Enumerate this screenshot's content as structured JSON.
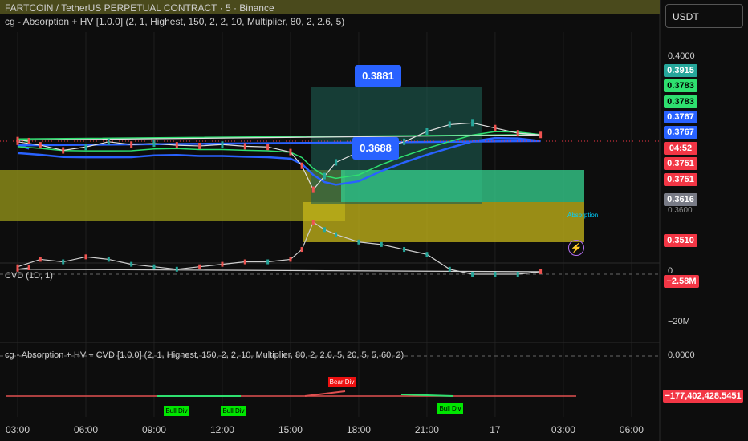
{
  "header": {
    "symbol_line": "FARTCOIN / TetherUS PERPETUAL CONTRACT · 5 · Binance",
    "indicator_line": "cg - Absorption + HV [1.0.0] (2, 1, Highest, 150, 2, 2, 10, Multiplier, 80, 2, 2.6, 5)",
    "currency": "USDT"
  },
  "callouts": {
    "upper": "0.3881",
    "lower": "0.3688"
  },
  "cvd": {
    "title": "CVD (1D, 1)",
    "value_tag": "−2.58M",
    "tick_low": "−20M",
    "tick_zero": "0"
  },
  "oscillator": {
    "title": "cg - Absorption + HV + CVD [1.0.0] (2, 1, Highest, 150, 2, 2, 10, Multiplier, 80, 2, 2.6, 5, 20, 5, 5, 60, 2)",
    "zero_tick": "0.0000",
    "value_tag": "−177,402,428.5451",
    "labels": [
      {
        "text": "Bull Div",
        "time": "10:30",
        "type": "bull"
      },
      {
        "text": "Bull Div",
        "time": "13:00",
        "type": "bull"
      },
      {
        "text": "Bear Div",
        "time": "17:30",
        "type": "bear"
      },
      {
        "text": "Bull Div",
        "time": "23:00",
        "type": "bull"
      }
    ]
  },
  "price_tags": [
    {
      "value": "0.3915",
      "color": "#26a69a"
    },
    {
      "value": "0.3783",
      "color": "#2ee06f"
    },
    {
      "value": "0.3783",
      "color": "#2ee06f"
    },
    {
      "value": "0.3767",
      "color": "#2962ff"
    },
    {
      "value": "0.3767",
      "color": "#2962ff"
    },
    {
      "value": "04:52",
      "color": "#f23645"
    },
    {
      "value": "0.3751",
      "color": "#f23645"
    },
    {
      "value": "0.3751",
      "color": "#f23645"
    },
    {
      "value": "0.3616",
      "color": "#787b86"
    },
    {
      "value": "0.3510",
      "color": "#f23645"
    }
  ],
  "misc": {
    "partial_tick": "0.3600",
    "absorption_label": "Absorption"
  },
  "chart_data": {
    "type": "line",
    "title": "FARTCOIN / TetherUS PERPETUAL CONTRACT · 5 · Binance",
    "x_ticks": [
      "03:00",
      "06:00",
      "09:00",
      "12:00",
      "15:00",
      "18:00",
      "21:00",
      "17",
      "03:00",
      "06:00"
    ],
    "y_ticks": [
      "0.4000"
    ],
    "ylim": [
      0.347,
      0.402
    ],
    "series": [
      {
        "name": "FARTCOIN/USDT",
        "times": [
          "03:00",
          "04:00",
          "05:00",
          "06:00",
          "07:00",
          "08:00",
          "09:00",
          "10:00",
          "11:00",
          "12:00",
          "13:00",
          "14:00",
          "15:00",
          "15:30",
          "16:00",
          "16:30",
          "17:00",
          "18:00",
          "19:00",
          "20:00",
          "21:00",
          "22:00",
          "23:00",
          "00:00",
          "01:00",
          "02:00",
          "03:00",
          "03:30"
        ],
        "values": [
          0.377,
          0.376,
          0.3745,
          0.3755,
          0.377,
          0.3762,
          0.3765,
          0.376,
          0.3758,
          0.3762,
          0.3757,
          0.3755,
          0.374,
          0.37,
          0.363,
          0.367,
          0.371,
          0.374,
          0.375,
          0.377,
          0.38,
          0.382,
          0.3825,
          0.381,
          0.3795,
          0.379,
          0.3775,
          0.3772
        ]
      }
    ],
    "cvd_series": {
      "name": "CVD (1D, 1)",
      "values_M": [
        -3,
        -6,
        -5,
        -7,
        -6,
        -4,
        -3,
        -2,
        -3,
        -4,
        -5,
        -5,
        -6,
        -10,
        -21,
        -18,
        -16,
        -13,
        -12,
        -10,
        -8,
        -2,
        0,
        0,
        0,
        -1,
        -2,
        -2.58
      ]
    }
  }
}
